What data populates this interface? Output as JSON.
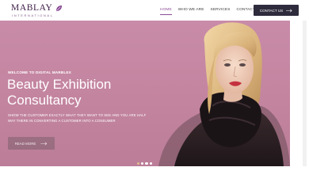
{
  "brand": {
    "name": "MABLAY",
    "subtitle": "INTERNATIONAL",
    "logo_icon": "gem-leaf-icon",
    "accent": "#8a4b96"
  },
  "nav": {
    "items": [
      {
        "label": "HOME",
        "active": true
      },
      {
        "label": "WHO WE ARE",
        "active": false
      },
      {
        "label": "SERVICES",
        "active": false
      },
      {
        "label": "CONTACT US",
        "active": false
      }
    ],
    "cta_label": "CONTACT US",
    "cta_icon": "arrow-right-icon",
    "cta_color": "#2d2b3c"
  },
  "hero": {
    "eyebrow": "WELCOME TO DIGITAL MARBLEX",
    "title_line1": "Beauty Exhibition",
    "title_line2": "Consultancy",
    "subtext": "SHOW THE CUSTOMER EXACTLY WHAT THEY WANT TO SEE AND YOU ARE HALF WAY THERE IN CONVERTING A CUSTOMER INTO A CONSUMER",
    "button_label": "READ MORE",
    "button_icon": "arrow-right-icon",
    "background": "#c3849f",
    "slides": {
      "count": 4,
      "active": 1
    }
  }
}
